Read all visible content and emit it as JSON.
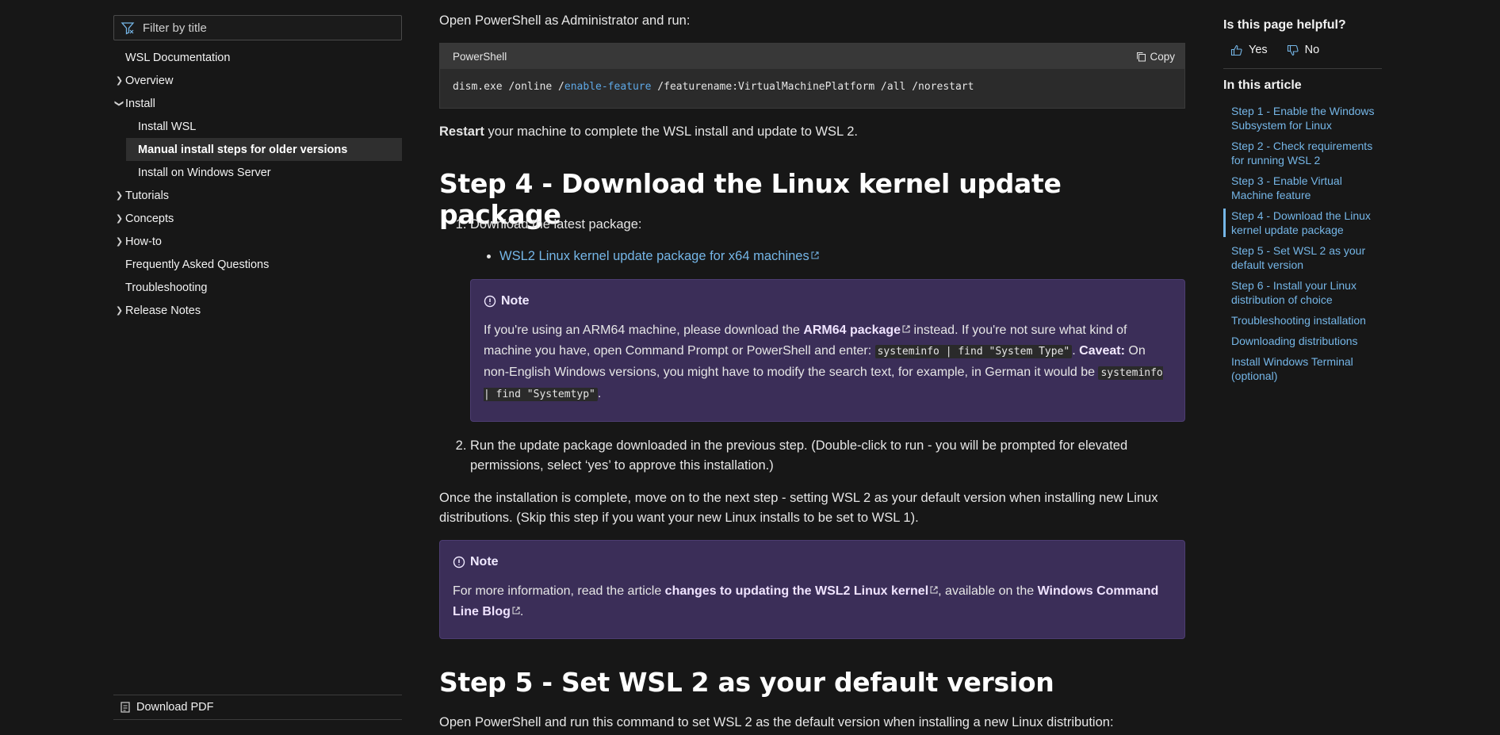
{
  "leftnav": {
    "filter_placeholder": "Filter by title",
    "items": [
      {
        "label": "WSL Documentation"
      },
      {
        "label": "Overview"
      },
      {
        "label": "Install"
      },
      {
        "label": "Install WSL"
      },
      {
        "label": "Manual install steps for older versions"
      },
      {
        "label": "Install on Windows Server"
      },
      {
        "label": "Tutorials"
      },
      {
        "label": "Concepts"
      },
      {
        "label": "How-to"
      },
      {
        "label": "Frequently Asked Questions"
      },
      {
        "label": "Troubleshooting"
      },
      {
        "label": "Release Notes"
      }
    ],
    "download_pdf": "Download PDF"
  },
  "main": {
    "intro": "Open PowerShell as Administrator and run:",
    "code": {
      "lang": "PowerShell",
      "copy": "Copy",
      "cmd_a": "dism.exe /online /",
      "cmd_kw": "enable-feature",
      "cmd_b": " /featurename:VirtualMachinePlatform /all /norestart"
    },
    "restart_bold": "Restart",
    "restart_rest": " your machine to complete the WSL install and update to WSL 2.",
    "step4_heading": "Step 4 - Download the Linux kernel update package",
    "step4_item1": "Download the latest package:",
    "step4_link": "WSL2 Linux kernel update package for x64 machines",
    "note1": {
      "title": "Note",
      "t1": "If you're using an ARM64 machine, please download the ",
      "link": "ARM64 package",
      "t2": " instead. If you're not sure what kind of machine you have, open Command Prompt or PowerShell and enter: ",
      "code1": "systeminfo | find \"System Type\"",
      "t3": ". ",
      "caveat": "Caveat:",
      "t4": " On non-English Windows versions, you might have to modify the search text, for example, in German it would be ",
      "code2": "systeminfo | find \"Systemtyp\"",
      "t5": "."
    },
    "step4_item2": "Run the update package downloaded in the previous step. (Double-click to run - you will be prompted for elevated permissions, select ‘yes’ to approve this installation.)",
    "once_complete": "Once the installation is complete, move on to the next step - setting WSL 2 as your default version when installing new Linux distributions. (Skip this step if you want your new Linux installs to be set to WSL 1).",
    "note2": {
      "title": "Note",
      "t1": "For more information, read the article ",
      "link1": "changes to updating the WSL2 Linux kernel",
      "t2": ", available on the ",
      "link2": "Windows Command Line Blog",
      "t3": "."
    },
    "step5_heading": "Step 5 - Set WSL 2 as your default version",
    "step5_intro": "Open PowerShell and run this command to set WSL 2 as the default version when installing a new Linux distribution:"
  },
  "right": {
    "helpful_title": "Is this page helpful?",
    "yes": "Yes",
    "no": "No",
    "in_this_article": "In this article",
    "toc": [
      {
        "label": "Step 1 - Enable the Windows Subsystem for Linux"
      },
      {
        "label": "Step 2 - Check requirements for running WSL 2"
      },
      {
        "label": "Step 3 - Enable Virtual Machine feature"
      },
      {
        "label": "Step 4 - Download the Linux kernel update package"
      },
      {
        "label": "Step 5 - Set WSL 2 as your default version"
      },
      {
        "label": "Step 6 - Install your Linux distribution of choice"
      },
      {
        "label": "Troubleshooting installation"
      },
      {
        "label": "Downloading distributions"
      },
      {
        "label": "Install Windows Terminal (optional)"
      }
    ]
  },
  "colors": {
    "background": "#171717",
    "link": "#75b6e7",
    "note_bg": "#3b2e58",
    "code_bg": "#2b2b2b"
  }
}
